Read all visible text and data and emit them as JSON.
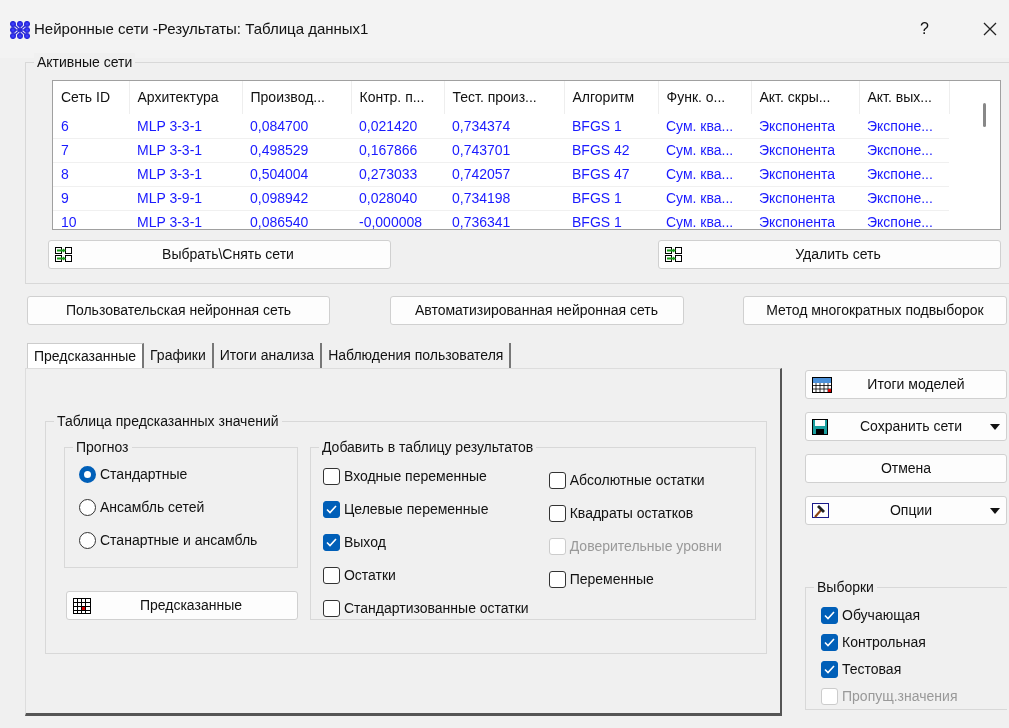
{
  "window": {
    "title": "Нейронные сети -Результаты: Таблица данных1",
    "help": "?"
  },
  "active_networks": {
    "label": "Активные сети",
    "table": {
      "columns": [
        "Сеть ID",
        "Архитектура",
        "Производ...",
        "Контр. п...",
        "Тест. произ...",
        "Алгоритм",
        "Функ. о...",
        "Акт. скры...",
        "Акт. вых..."
      ],
      "rows": [
        [
          "6",
          "MLP 3-3-1",
          "0,084700",
          "0,021420",
          "0,734374",
          "BFGS 1",
          "Сум. ква...",
          "Экспонента",
          "Экспоне..."
        ],
        [
          "7",
          "MLP 3-3-1",
          "0,498529",
          "0,167866",
          "0,743701",
          "BFGS 42",
          "Сум. ква...",
          "Экспонента",
          "Экспоне..."
        ],
        [
          "8",
          "MLP 3-3-1",
          "0,504004",
          "0,273033",
          "0,742057",
          "BFGS 47",
          "Сум. ква...",
          "Экспонента",
          "Экспоне..."
        ],
        [
          "9",
          "MLP 3-9-1",
          "0,098942",
          "0,028040",
          "0,734198",
          "BFGS 1",
          "Сум. ква...",
          "Экспонента",
          "Экспоне..."
        ],
        [
          "10",
          "MLP 3-3-1",
          "0,086540",
          "-0,000008",
          "0,736341",
          "BFGS 1",
          "Сум. ква...",
          "Экспонента",
          "Экспоне..."
        ]
      ]
    },
    "buttons": [
      {
        "label": "Выбрать\\Снять сети"
      },
      {
        "label": "Удалить сеть"
      }
    ]
  },
  "model_buttons": [
    "Пользовательская нейронная сеть",
    "Автоматизированная нейронная сеть",
    "Метод многократных подвыборок"
  ],
  "tabs": [
    {
      "label": "Предсказанные",
      "selected": true
    },
    {
      "label": "Графики",
      "selected": false
    },
    {
      "label": "Итоги анализа",
      "selected": false
    },
    {
      "label": "Наблюдения пользователя",
      "selected": false
    }
  ],
  "predicted_table": {
    "label": "Таблица предсказанных значений",
    "forecast": {
      "label": "Прогноз",
      "options": [
        {
          "label": "Стандартные",
          "selected": true
        },
        {
          "label": "Ансамбль сетей",
          "selected": false
        },
        {
          "label": "Станартные и ансамбль",
          "selected": false
        }
      ]
    },
    "predicted_button": "Предсказанные",
    "add_to_results": {
      "label": "Добавить в таблицу результатов",
      "columns": [
        {
          "items": [
            {
              "label": "Входные переменные",
              "checked": false,
              "disabled": false
            },
            {
              "label": "Целевые переменные",
              "checked": true,
              "disabled": false
            },
            {
              "label": "Выход",
              "checked": true,
              "disabled": false
            },
            {
              "label": "Остатки",
              "checked": false,
              "disabled": false
            },
            {
              "label": "Стандартизованные остатки",
              "checked": false,
              "disabled": false
            }
          ]
        },
        {
          "items": [
            {
              "label": "Абсолютные остатки",
              "checked": false,
              "disabled": false
            },
            {
              "label": "Квадраты остатков",
              "checked": false,
              "disabled": false
            },
            {
              "label": "Доверительные уровни",
              "checked": false,
              "disabled": true
            },
            {
              "label": "Переменные",
              "checked": false,
              "disabled": false
            }
          ]
        }
      ]
    }
  },
  "side_buttons": [
    {
      "label": "Итоги моделей",
      "kind": "icon"
    },
    {
      "label": "Сохранить сети",
      "kind": "icon-dropdown"
    },
    {
      "label": "Отмена",
      "kind": "plain"
    },
    {
      "label": "Опции",
      "kind": "icon-dropdown"
    }
  ],
  "samples": {
    "label": "Выборки",
    "items": [
      {
        "label": "Обучающая",
        "checked": true,
        "disabled": false
      },
      {
        "label": "Контрольная",
        "checked": true,
        "disabled": false
      },
      {
        "label": "Тестовая",
        "checked": true,
        "disabled": false
      },
      {
        "label": "Пропущ.значения",
        "checked": false,
        "disabled": true
      }
    ]
  }
}
